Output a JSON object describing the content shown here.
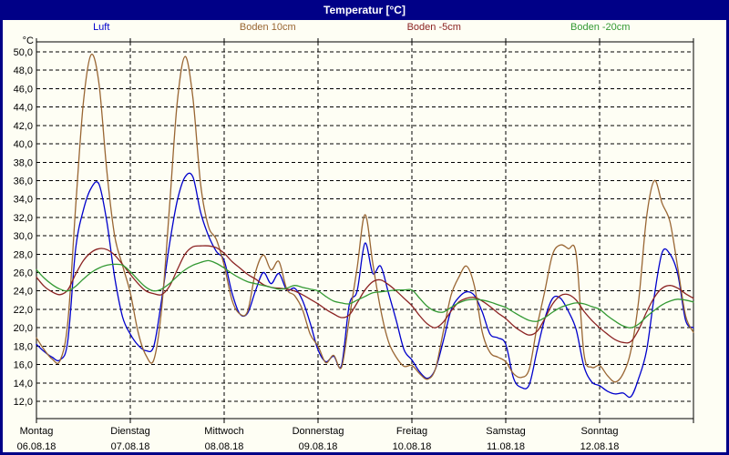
{
  "window": {
    "title": "Temperatur [°C]"
  },
  "colors": {
    "frame": "#000087",
    "titlebar_bg": "#000087",
    "titlebar_text": "#ffffff",
    "plot_bg": "#fefef4",
    "grid": "#000000",
    "luft": "#0000cc",
    "boden10": "#996633",
    "boden5": "#8b2323",
    "boden20": "#339933"
  },
  "legend": [
    {
      "id": "luft",
      "label": "Luft",
      "color": "#0000cc"
    },
    {
      "id": "boden10",
      "label": "Boden 10cm",
      "color": "#996633"
    },
    {
      "id": "boden5",
      "label": "Boden -5cm",
      "color": "#8b2323"
    },
    {
      "id": "boden20",
      "label": "Boden -20cm",
      "color": "#339933"
    }
  ],
  "y_axis": {
    "unit": "°C",
    "min": 12,
    "max": 50,
    "step": 2,
    "decimal_separator": ","
  },
  "x_axis": {
    "days": [
      {
        "weekday": "Montag",
        "date": "06.08.18"
      },
      {
        "weekday": "Dienstag",
        "date": "07.08.18"
      },
      {
        "weekday": "Mittwoch",
        "date": "08.08.18"
      },
      {
        "weekday": "Donnerstag",
        "date": "09.08.18"
      },
      {
        "weekday": "Freitag",
        "date": "10.08.18"
      },
      {
        "weekday": "Samstag",
        "date": "11.08.18"
      },
      {
        "weekday": "Sonntag",
        "date": "12.08.18"
      }
    ]
  },
  "chart_data": {
    "type": "line",
    "title": "Temperatur [°C]",
    "ylabel": "°C",
    "ylim": [
      12,
      50
    ],
    "grid": "dashed",
    "legend_position": "top",
    "x_start_hour": 0,
    "x_step_hours": 2,
    "x_total_hours": 168,
    "series": [
      {
        "id": "luft",
        "name": "Luft",
        "color": "#0000cc",
        "values": [
          18.2,
          17.4,
          16.8,
          16.5,
          18.5,
          28.5,
          32.8,
          35.2,
          35.6,
          31.5,
          25.5,
          21.2,
          19.3,
          18.1,
          17.5,
          18.0,
          23.0,
          29.0,
          33.8,
          36.4,
          36.4,
          32.5,
          30.0,
          28.3,
          27.3,
          23.8,
          21.5,
          21.6,
          24.0,
          26.0,
          24.8,
          25.9,
          24.1,
          24.3,
          23.0,
          20.5,
          17.6,
          16.3,
          16.9,
          15.9,
          22.5,
          24.0,
          29.2,
          25.9,
          26.7,
          23.8,
          20.8,
          17.6,
          16.5,
          15.2,
          14.5,
          15.5,
          18.5,
          21.9,
          23.3,
          23.9,
          23.5,
          21.7,
          19.3,
          18.9,
          18.2,
          14.5,
          13.5,
          13.8,
          17.5,
          21.0,
          23.2,
          23.2,
          21.8,
          19.8,
          15.8,
          14.1,
          13.7,
          13.1,
          12.8,
          12.9,
          12.5,
          14.5,
          17.5,
          23.5,
          28.2,
          28.0,
          25.8,
          20.8,
          20.0
        ]
      },
      {
        "id": "boden10",
        "name": "Boden 10cm",
        "color": "#996633",
        "values": [
          18.9,
          17.6,
          16.6,
          16.4,
          20.5,
          33.0,
          44.5,
          49.7,
          46.5,
          37.0,
          30.0,
          26.8,
          23.8,
          19.5,
          17.0,
          16.5,
          22.0,
          33.0,
          44.5,
          49.5,
          45.0,
          35.5,
          31.0,
          29.6,
          26.8,
          23.0,
          21.5,
          21.8,
          26.0,
          27.9,
          26.3,
          27.2,
          24.2,
          23.5,
          22.0,
          19.3,
          18.0,
          16.2,
          17.0,
          15.7,
          21.0,
          26.5,
          32.3,
          27.0,
          22.0,
          18.5,
          16.8,
          15.8,
          15.9,
          15.0,
          14.4,
          15.5,
          19.5,
          23.5,
          25.5,
          26.7,
          24.5,
          19.5,
          17.3,
          16.8,
          16.3,
          15.0,
          14.6,
          15.5,
          20.1,
          24.0,
          28.0,
          29.0,
          28.6,
          28.0,
          17.2,
          15.7,
          15.9,
          14.8,
          14.1,
          15.0,
          17.5,
          23.0,
          32.0,
          36.0,
          33.5,
          31.5,
          26.5,
          21.3,
          19.5
        ]
      },
      {
        "id": "boden5",
        "name": "Boden -5cm",
        "color": "#8b2323",
        "values": [
          25.5,
          24.5,
          23.9,
          23.6,
          24.1,
          25.8,
          27.3,
          28.2,
          28.6,
          28.5,
          27.9,
          26.9,
          25.8,
          24.8,
          24.0,
          23.7,
          23.6,
          24.5,
          26.3,
          28.0,
          28.8,
          28.9,
          28.9,
          28.7,
          28.1,
          27.2,
          26.5,
          25.8,
          25.3,
          24.7,
          24.4,
          24.3,
          24.2,
          24.0,
          23.6,
          23.1,
          22.6,
          22.0,
          21.5,
          21.1,
          21.4,
          22.7,
          24.1,
          25.0,
          25.2,
          24.7,
          24.0,
          23.2,
          22.4,
          21.3,
          20.4,
          20.0,
          20.6,
          21.8,
          22.8,
          23.2,
          23.3,
          22.9,
          22.3,
          21.6,
          21.0,
          20.2,
          19.6,
          19.2,
          19.6,
          21.0,
          22.6,
          23.5,
          23.6,
          23.0,
          21.8,
          20.8,
          20.0,
          19.3,
          18.7,
          18.4,
          18.5,
          19.8,
          21.7,
          23.3,
          24.3,
          24.6,
          24.3,
          23.7,
          23.2
        ]
      },
      {
        "id": "boden20",
        "name": "Boden -20cm",
        "color": "#339933",
        "values": [
          26.3,
          25.4,
          24.7,
          24.2,
          24.0,
          24.5,
          25.3,
          26.0,
          26.5,
          26.8,
          26.9,
          26.8,
          26.1,
          25.2,
          24.4,
          24.0,
          24.2,
          24.8,
          25.6,
          26.3,
          26.8,
          27.1,
          27.3,
          27.0,
          26.5,
          25.9,
          25.4,
          25.0,
          24.8,
          24.6,
          24.4,
          24.2,
          24.3,
          24.6,
          24.4,
          24.2,
          24.0,
          23.4,
          22.9,
          22.7,
          22.6,
          23.0,
          23.4,
          23.8,
          23.9,
          24.0,
          24.1,
          24.1,
          24.1,
          23.2,
          22.3,
          21.8,
          21.7,
          22.2,
          22.7,
          23.0,
          23.1,
          23.0,
          22.8,
          22.5,
          22.2,
          21.7,
          21.2,
          20.8,
          20.7,
          21.1,
          21.7,
          22.2,
          22.5,
          22.7,
          22.6,
          22.3,
          22.0,
          21.3,
          20.7,
          20.2,
          20.0,
          20.4,
          21.2,
          21.9,
          22.5,
          22.9,
          23.1,
          23.0,
          22.8
        ]
      }
    ]
  }
}
